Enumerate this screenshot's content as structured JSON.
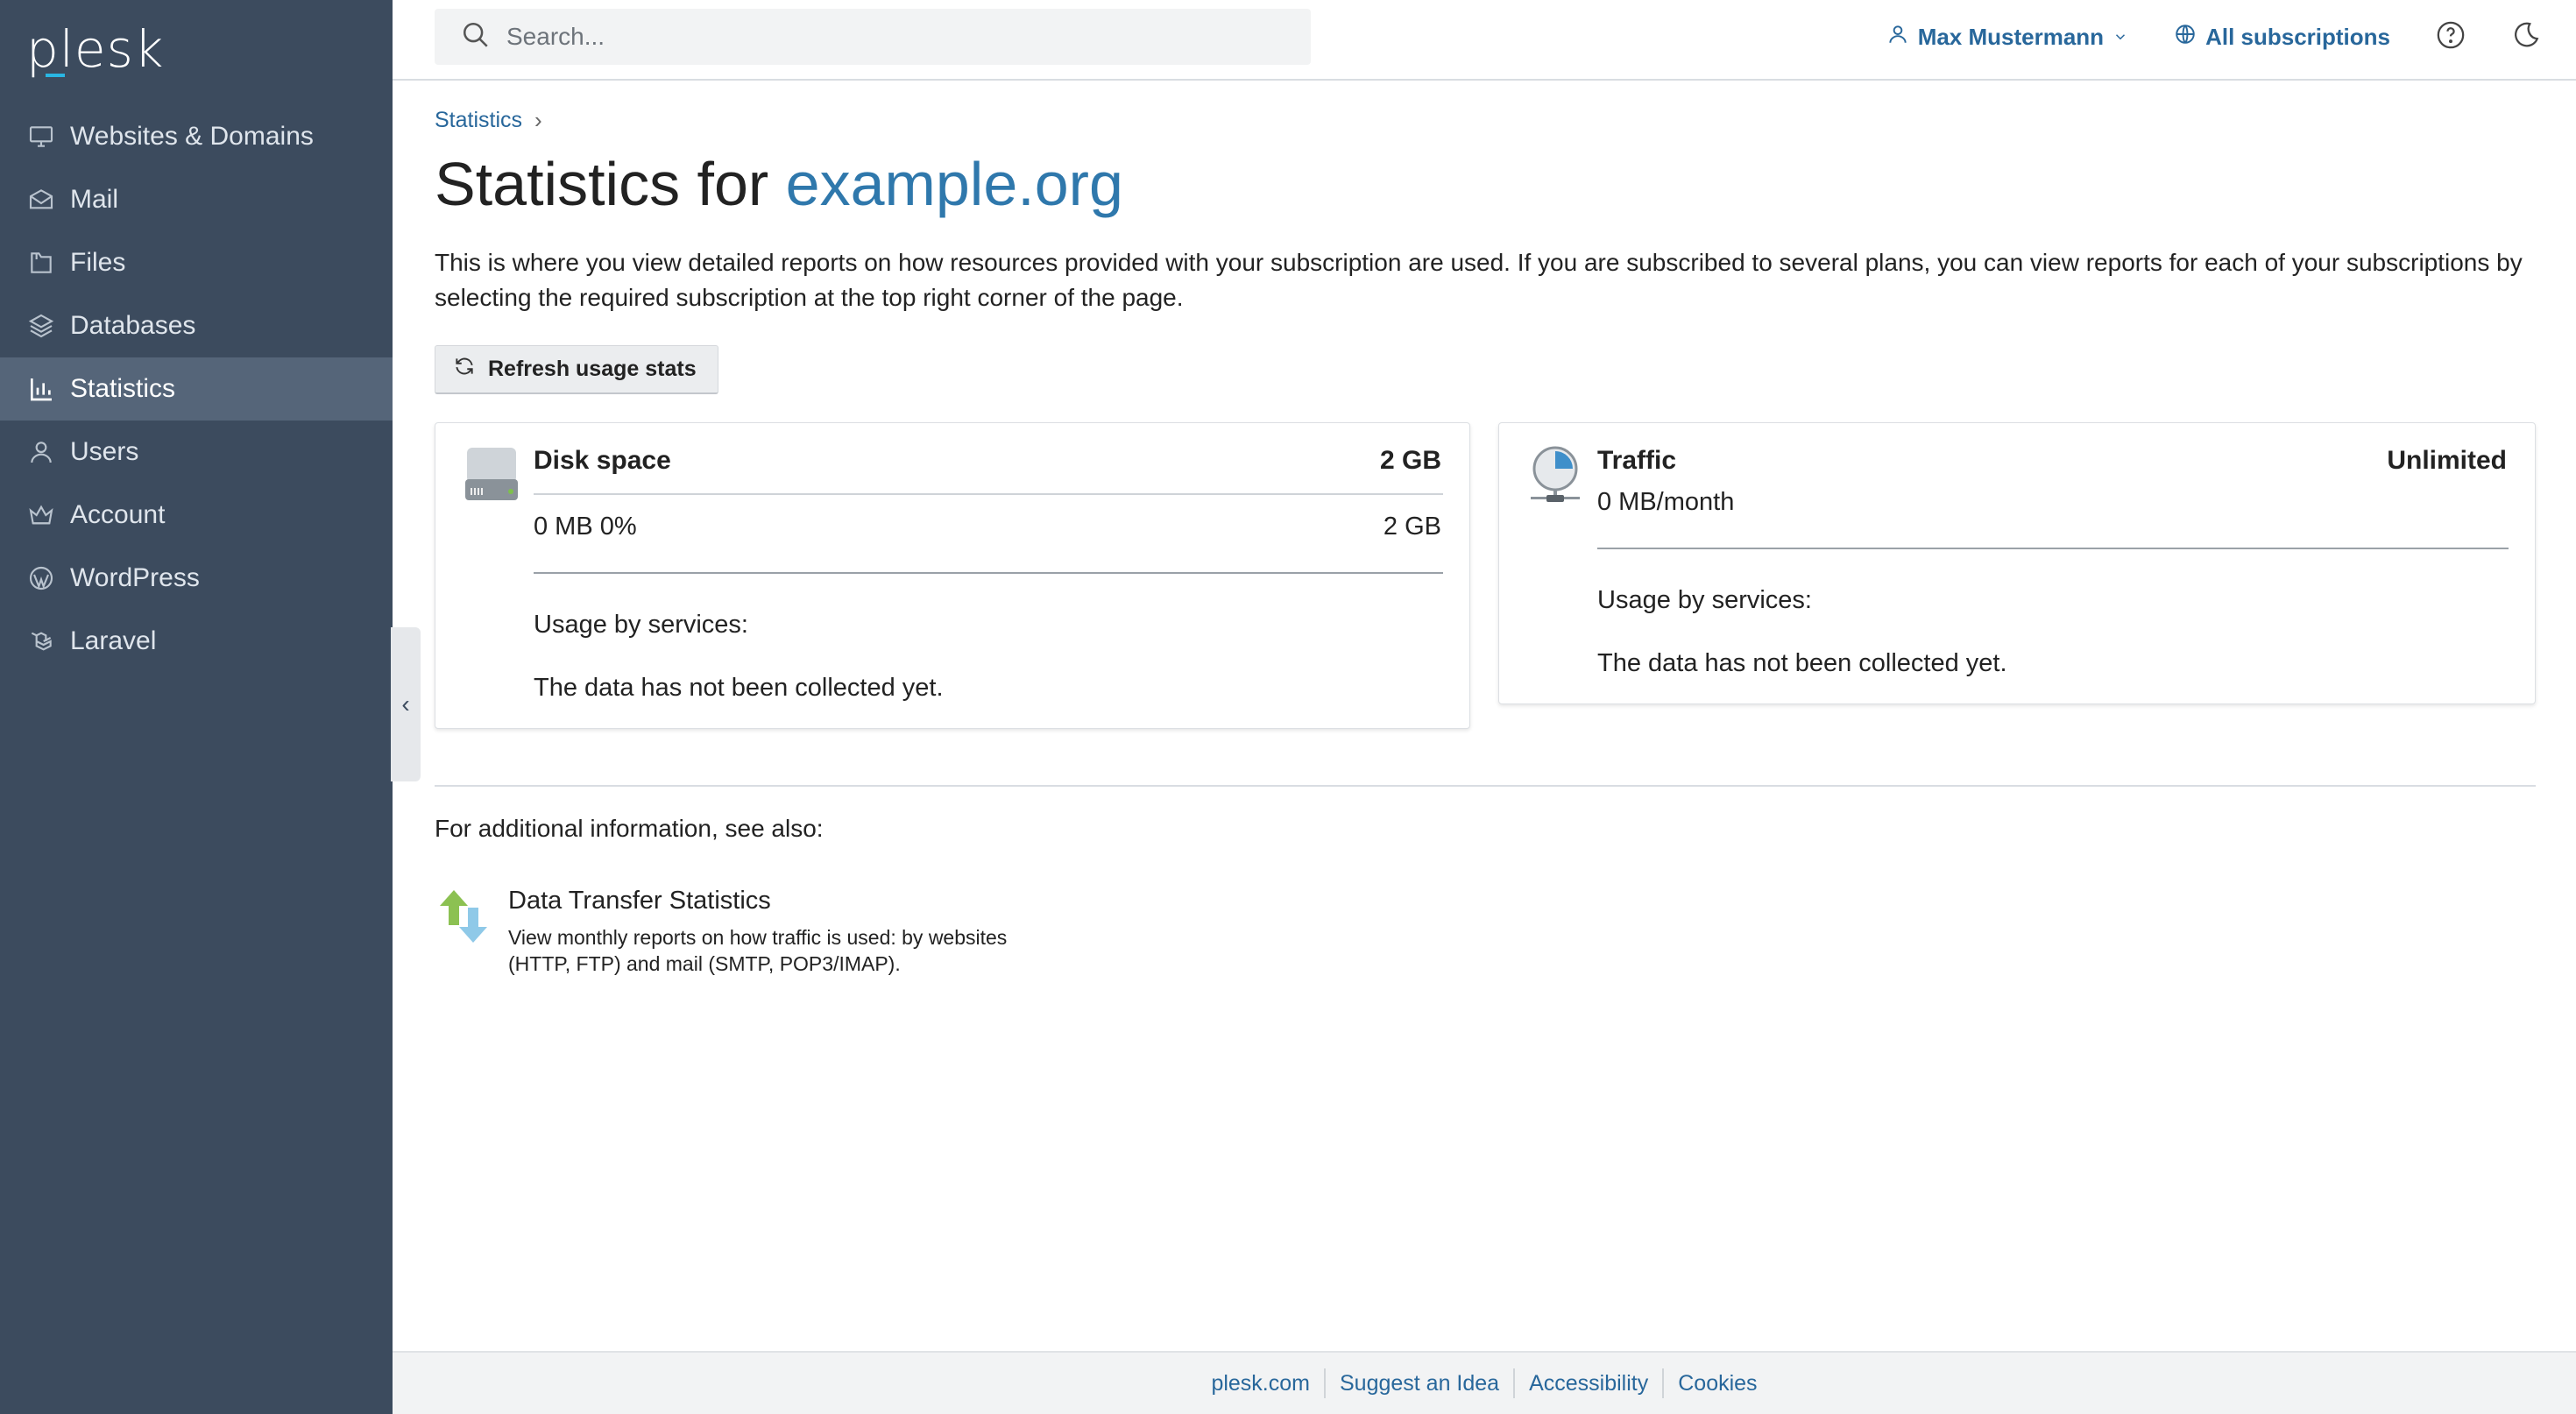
{
  "app": {
    "logo": "plesk"
  },
  "sidebar": {
    "items": [
      {
        "label": "Websites & Domains",
        "icon": "monitor-icon"
      },
      {
        "label": "Mail",
        "icon": "envelope-icon"
      },
      {
        "label": "Files",
        "icon": "folder-icon"
      },
      {
        "label": "Databases",
        "icon": "layers-icon"
      },
      {
        "label": "Statistics",
        "icon": "bar-chart-icon",
        "active": true
      },
      {
        "label": "Users",
        "icon": "user-icon"
      },
      {
        "label": "Account",
        "icon": "crown-icon"
      },
      {
        "label": "WordPress",
        "icon": "wordpress-icon"
      },
      {
        "label": "Laravel",
        "icon": "laravel-icon"
      }
    ]
  },
  "header": {
    "search_placeholder": "Search...",
    "user_name": "Max Mustermann",
    "subscriptions_label": "All subscriptions"
  },
  "main": {
    "breadcrumb": "Statistics",
    "title_prefix": "Statistics for",
    "title_domain": "example.org",
    "description": "This is where you view detailed reports on how resources provided with your subscription are used. If you are subscribed to several plans, you can view reports for each of your subscriptions by selecting the required subscription at the top right corner of the page.",
    "refresh_label": "Refresh usage stats",
    "disk": {
      "title": "Disk space",
      "limit": "2 GB",
      "usage": "0 MB 0%",
      "usage_right": "2 GB",
      "services_label": "Usage by services:",
      "no_data": "The data has not been collected yet."
    },
    "traffic": {
      "title": "Traffic",
      "limit": "Unlimited",
      "usage": "0 MB/month",
      "services_label": "Usage by services:",
      "no_data": "The data has not been collected yet."
    },
    "see_also": "For additional information, see also:",
    "related": {
      "title": "Data Transfer Statistics",
      "desc_line1": "View monthly reports on how traffic is used: by websites",
      "desc_line2": "(HTTP, FTP) and mail (SMTP, POP3/IMAP)."
    }
  },
  "footer": {
    "links": [
      "plesk.com",
      "Suggest an Idea",
      "Accessibility",
      "Cookies"
    ]
  },
  "colors": {
    "sidebar_bg": "#3c4b5e",
    "sidebar_active": "#556579",
    "link": "#28679b",
    "brand_accent": "#29b6e3"
  }
}
